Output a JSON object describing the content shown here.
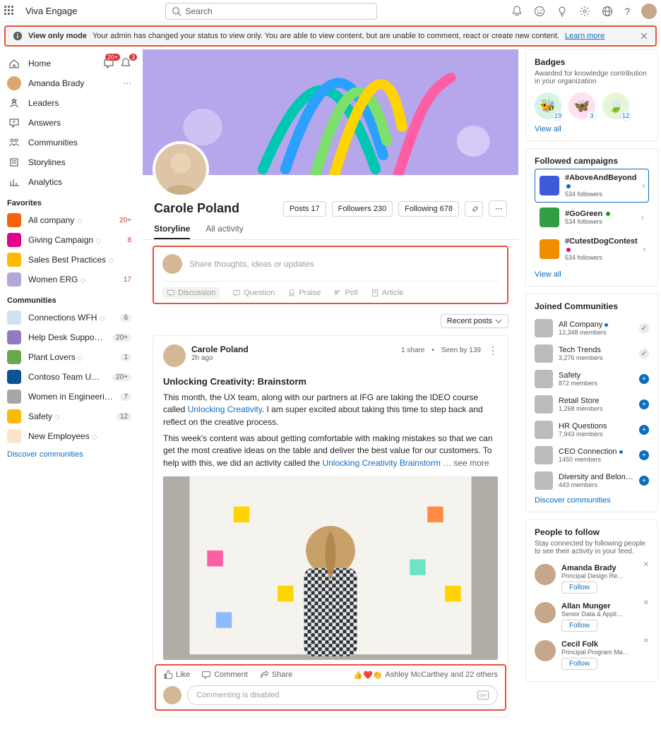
{
  "app": {
    "title": "Viva Engage",
    "search_placeholder": "Search"
  },
  "banner": {
    "title": "View only mode",
    "text": "Your admin has changed your status to view only. You are able to view content, but are unable to comment, react or create new content.",
    "learn": "Learn more"
  },
  "nav": {
    "home": "Home",
    "user": "Amanda Brady",
    "items": [
      {
        "label": "Leaders"
      },
      {
        "label": "Answers"
      },
      {
        "label": "Communities"
      },
      {
        "label": "Storylines"
      },
      {
        "label": "Analytics"
      }
    ],
    "chat_badge": "20+",
    "bell_badge": "3"
  },
  "favorites_title": "Favorites",
  "favorites": [
    {
      "label": "All company",
      "count": "20+",
      "color": "#f7630c"
    },
    {
      "label": "Giving Campaign",
      "count": "8",
      "color": "#e3008c"
    },
    {
      "label": "Sales Best Practices",
      "count": "",
      "color": "#ffb900"
    },
    {
      "label": "Women ERG",
      "count": "17",
      "color": "#b4a7d6"
    }
  ],
  "communities_title": "Communities",
  "communities_left": [
    {
      "label": "Connections WFH",
      "count": "6",
      "color": "#cfe2f3"
    },
    {
      "label": "Help Desk Support",
      "count": "20+",
      "color": "#8e7cc3"
    },
    {
      "label": "Plant Lovers",
      "count": "1",
      "color": "#6aa84f"
    },
    {
      "label": "Contoso Team UX (Desig…",
      "count": "20+",
      "color": "#0b5394"
    },
    {
      "label": "Women in Engineering",
      "count": "7",
      "color": "#a6a6a6"
    },
    {
      "label": "Safety",
      "count": "12",
      "color": "#ffb900"
    },
    {
      "label": "New Employees",
      "count": "",
      "color": "#fce5cd"
    }
  ],
  "discover": "Discover communities",
  "profile": {
    "name": "Carole Poland",
    "posts": "Posts 17",
    "followers": "Followers 230",
    "following": "Following 678"
  },
  "tabs": {
    "storyline": "Storyline",
    "all": "All activity"
  },
  "composer": {
    "placeholder": "Share thoughts, ideas or updates",
    "types": {
      "discussion": "Discussion",
      "question": "Question",
      "praise": "Praise",
      "poll": "Poll",
      "article": "Article"
    }
  },
  "sort": "Recent posts",
  "post": {
    "author": "Carole Poland",
    "time": "2h ago",
    "shares": "1 share",
    "seen": "Seen by 139",
    "title": "Unlocking Creativity: Brainstorm",
    "p1a": "This month, the UX team, along with our partners at IFG are taking the IDEO course called ",
    "p1link": "Unlocking Creativity",
    "p1b": ". I am super excited about taking this time to step back and reflect on the creative process.",
    "p2a": "This week's content was about getting comfortable with making mistakes so that we can get the most creative ideas on the table and deliver the best value for our customers. To help with this, we did an activity called the ",
    "p2link": "Unlocking Creativity Brainstorm",
    "seemore": " … see more",
    "like": "Like",
    "comment": "Comment",
    "share": "Share",
    "reactors": "Ashley McCarthey and 22 others",
    "comment_disabled": "Commenting is disabled"
  },
  "badges": {
    "title": "Badges",
    "sub": "Awarded for knowledge contribution in your organization",
    "values": [
      "19",
      "3",
      "12"
    ],
    "viewall": "View all"
  },
  "campaigns": {
    "title": "Followed campaigns",
    "items": [
      {
        "name": "#AboveAndBeyond",
        "followers": "534 followers",
        "dot": "#0f6cbd"
      },
      {
        "name": "#GoGreen",
        "followers": "534 followers",
        "dot": "#13a10e"
      },
      {
        "name": "#CutestDogContest",
        "followers": "534 followers",
        "dot": "#e3008c"
      }
    ],
    "viewall": "View all"
  },
  "joined": {
    "title": "Joined Communities",
    "items": [
      {
        "name": "All Company",
        "members": "12,348 members",
        "join": false,
        "dot": true
      },
      {
        "name": "Tech Trends",
        "members": "3,276 members",
        "join": false
      },
      {
        "name": "Safety",
        "members": "872 members",
        "join": true
      },
      {
        "name": "Retail Store",
        "members": "1,268 members",
        "join": true
      },
      {
        "name": "HR Questions",
        "members": "7,943 members",
        "join": true
      },
      {
        "name": "CEO Connection",
        "members": "1450 members",
        "join": true,
        "dot": true
      },
      {
        "name": "Diversity and Belonging",
        "members": "443 members",
        "join": true,
        "dot": true
      }
    ],
    "discover": "Discover communities"
  },
  "follow": {
    "title": "People to follow",
    "sub": "Stay connected by following people to see their activity in your feed.",
    "btn": "Follow",
    "people": [
      {
        "name": "Amanda Brady",
        "role": "Principal Design Re…"
      },
      {
        "name": "Allan Munger",
        "role": "Senior Data & Appli…"
      },
      {
        "name": "Cecil Folk",
        "role": "Principal Program Ma…"
      }
    ]
  }
}
